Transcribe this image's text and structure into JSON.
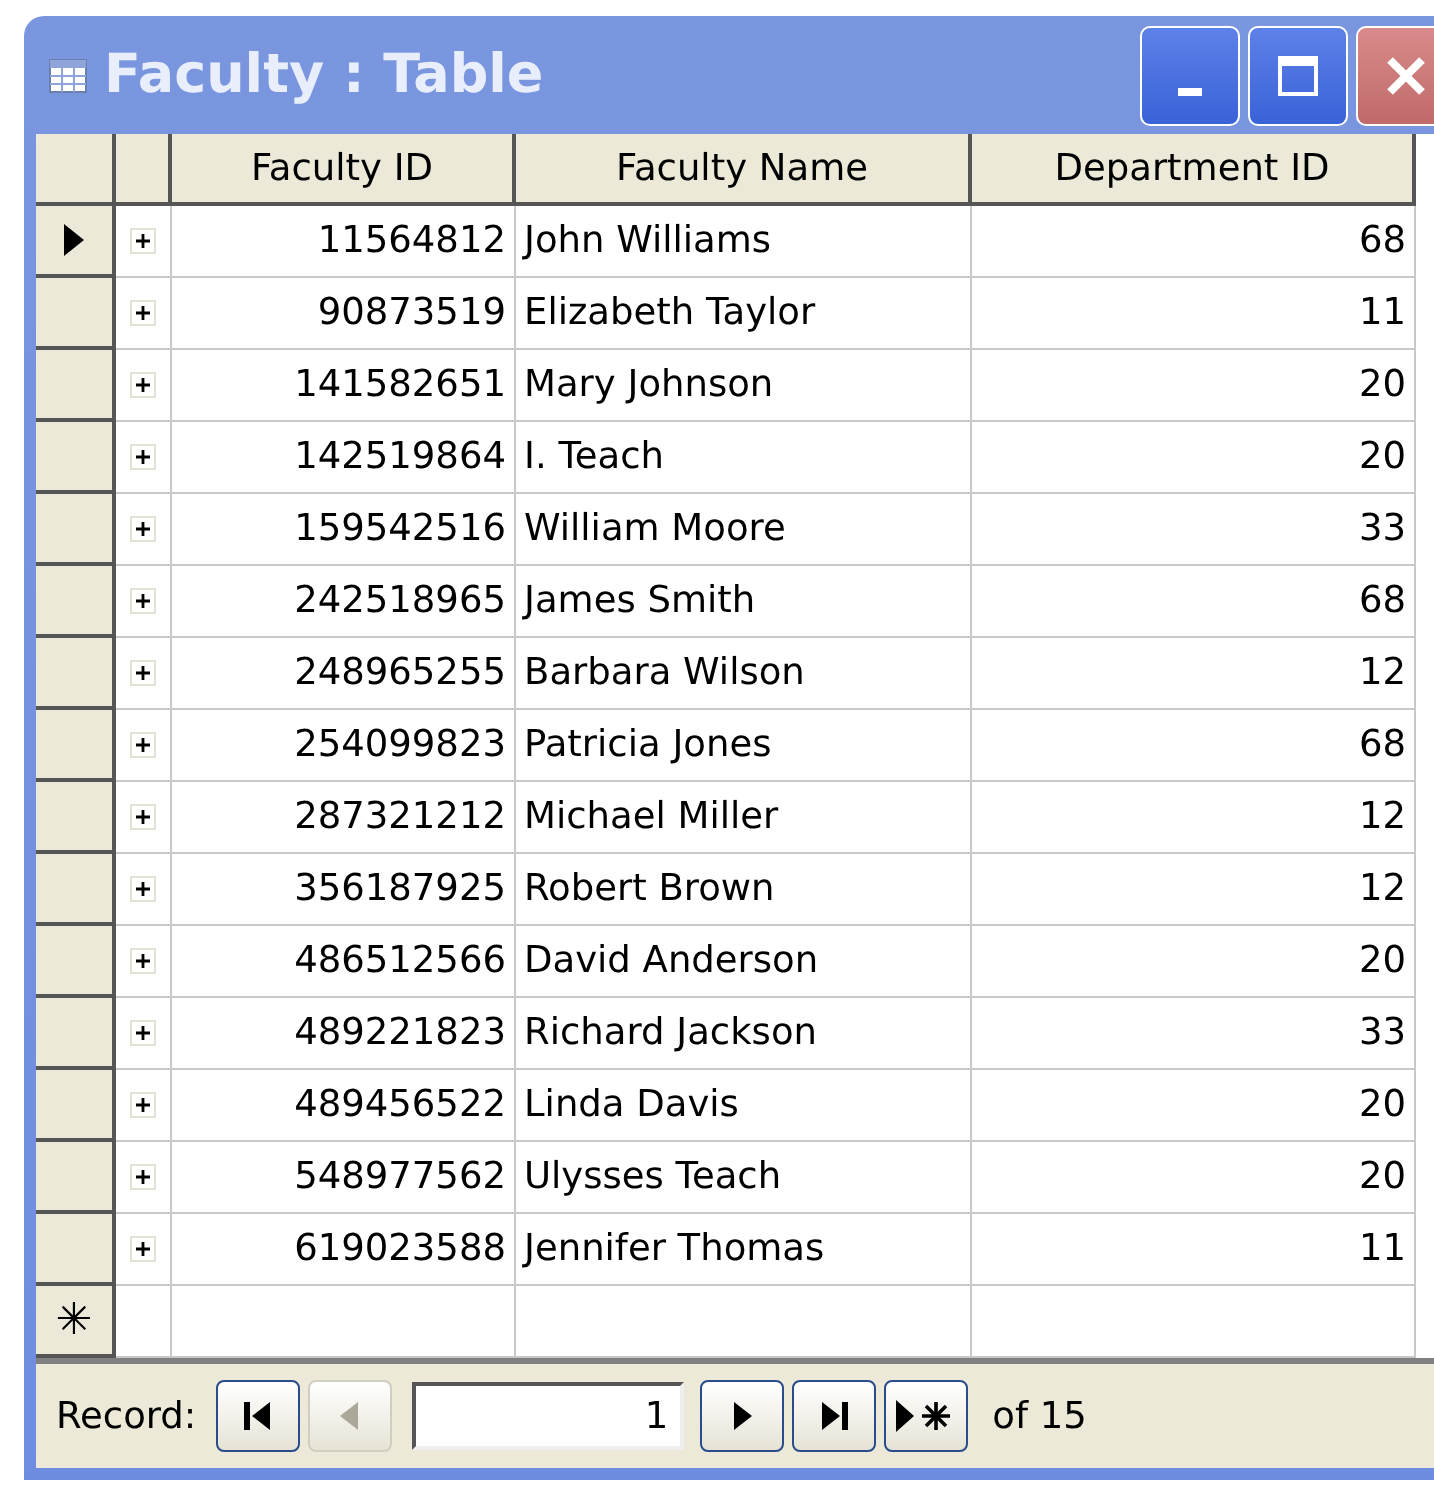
{
  "window": {
    "title": "Faculty : Table"
  },
  "table": {
    "columns": [
      "Faculty ID",
      "Faculty Name",
      "Department ID"
    ],
    "rows": [
      {
        "current": true,
        "cells": [
          "11564812",
          "John Williams",
          "68"
        ]
      },
      {
        "current": false,
        "cells": [
          "90873519",
          "Elizabeth Taylor",
          "11"
        ]
      },
      {
        "current": false,
        "cells": [
          "141582651",
          "Mary Johnson",
          "20"
        ]
      },
      {
        "current": false,
        "cells": [
          "142519864",
          "I. Teach",
          "20"
        ]
      },
      {
        "current": false,
        "cells": [
          "159542516",
          "William Moore",
          "33"
        ]
      },
      {
        "current": false,
        "cells": [
          "242518965",
          "James Smith",
          "68"
        ]
      },
      {
        "current": false,
        "cells": [
          "248965255",
          "Barbara Wilson",
          "12"
        ]
      },
      {
        "current": false,
        "cells": [
          "254099823",
          "Patricia Jones",
          "68"
        ]
      },
      {
        "current": false,
        "cells": [
          "287321212",
          "Michael Miller",
          "12"
        ]
      },
      {
        "current": false,
        "cells": [
          "356187925",
          "Robert Brown",
          "12"
        ]
      },
      {
        "current": false,
        "cells": [
          "486512566",
          "David Anderson",
          "20"
        ]
      },
      {
        "current": false,
        "cells": [
          "489221823",
          "Richard Jackson",
          "33"
        ]
      },
      {
        "current": false,
        "cells": [
          "489456522",
          "Linda Davis",
          "20"
        ]
      },
      {
        "current": false,
        "cells": [
          "548977562",
          "Ulysses Teach",
          "20"
        ]
      },
      {
        "current": false,
        "cells": [
          "619023588",
          "Jennifer Thomas",
          "11"
        ]
      }
    ],
    "new_row_marker": "✳"
  },
  "navigation": {
    "label": "Record:",
    "record": "1",
    "total": "of 15",
    "buttons": [
      {
        "kind": "first",
        "disabled": false
      },
      {
        "kind": "prev",
        "disabled": true
      },
      {
        "kind": "next",
        "disabled": false
      },
      {
        "kind": "last",
        "disabled": false
      },
      {
        "kind": "new",
        "disabled": false
      }
    ]
  }
}
